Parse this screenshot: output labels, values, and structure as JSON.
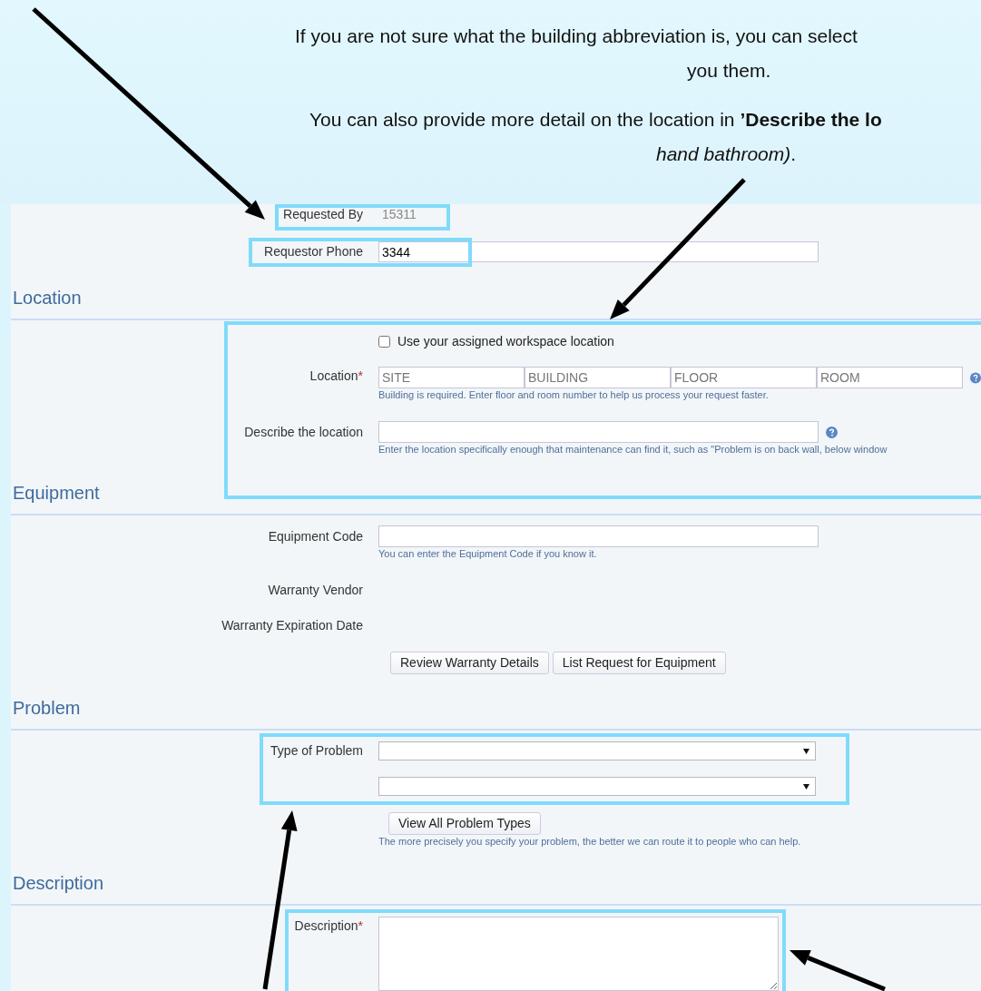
{
  "intro": [
    {
      "lines": [
        "If you are not sure what the building abbreviation is, you can select",
        "you them."
      ]
    },
    {
      "lines": [
        "You can also provide more detail on the location in **’Describe the lo**",
        "*hand bathroom)*."
      ]
    }
  ],
  "requester": {
    "requested_by_label": "Requested By",
    "requested_by": "15311",
    "phone_label": "Requestor Phone",
    "phone": "3344"
  },
  "location": {
    "heading": "Location",
    "workspace": {
      "label": "Use your assigned workspace location",
      "checked": false
    },
    "location_label": "Location",
    "required_mark": "*",
    "placeholders": [
      "SITE",
      "BUILDING",
      "FLOOR",
      "ROOM"
    ],
    "location_hint": "Building is required. Enter floor and room number to help us process your request faster.",
    "describe_label": "Describe the location",
    "describe_hint": "Enter the location specifically enough that maintenance can find it, such as \"Problem is on back wall, below window"
  },
  "equipment": {
    "heading": "Equipment",
    "code_label": "Equipment Code",
    "code_hint": "You can enter the Equipment Code if you know it.",
    "vendor_label": "Warranty Vendor",
    "expiration_label": "Warranty Expiration Date",
    "buttons": [
      "Review Warranty Details",
      "List Request for Equipment"
    ]
  },
  "problem": {
    "heading": "Problem",
    "type_label": "Type of Problem",
    "button": "View All Problem Types",
    "hint": "The more precisely you specify your problem, the better we can route it to people who can help."
  },
  "description": {
    "heading": "Description",
    "label": "Description",
    "required_mark": "*"
  }
}
